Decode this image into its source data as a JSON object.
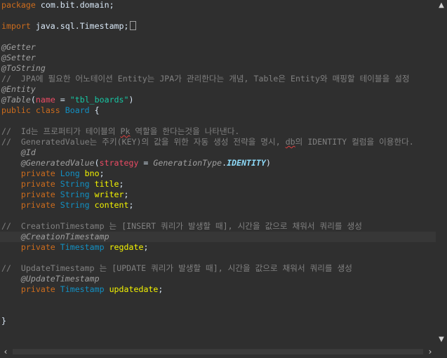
{
  "editor": {
    "lines": [
      {
        "tokens": [
          {
            "c": "kw",
            "t": "package"
          },
          {
            "c": "pl",
            "t": " com.bit.domain;"
          }
        ]
      },
      {
        "tokens": []
      },
      {
        "tokens": [
          {
            "c": "kw",
            "t": "import"
          },
          {
            "c": "pl",
            "t": " java.sql.Timestamp;"
          },
          {
            "c": "box",
            "t": ""
          }
        ]
      },
      {
        "tokens": []
      },
      {
        "tokens": [
          {
            "c": "an",
            "t": "@Getter"
          }
        ]
      },
      {
        "tokens": [
          {
            "c": "an",
            "t": "@Setter"
          }
        ]
      },
      {
        "tokens": [
          {
            "c": "an",
            "t": "@ToString"
          }
        ]
      },
      {
        "tokens": [
          {
            "c": "cm",
            "t": "//  JPA에 필요한 어노테이션 Entity는 JPA가 관리한다는 개념, Table은 Entity와 매핑할 테이블을 설정"
          }
        ]
      },
      {
        "tokens": [
          {
            "c": "an",
            "t": "@Entity"
          }
        ]
      },
      {
        "tokens": [
          {
            "c": "an",
            "t": "@Table"
          },
          {
            "c": "pl",
            "t": "("
          },
          {
            "c": "attr",
            "t": "name"
          },
          {
            "c": "pl",
            "t": " = "
          },
          {
            "c": "str",
            "t": "\"tbl_boards\""
          },
          {
            "c": "pl",
            "t": ")"
          }
        ]
      },
      {
        "tokens": [
          {
            "c": "kw",
            "t": "public class "
          },
          {
            "c": "cls",
            "t": "Board"
          },
          {
            "c": "pl",
            "t": " {"
          }
        ]
      },
      {
        "tokens": []
      },
      {
        "tokens": [
          {
            "c": "cm",
            "t": "//  Id는 프로퍼티가 테이블의 "
          },
          {
            "c": "cmsq",
            "t": "Pk"
          },
          {
            "c": "cm",
            "t": " 역할을 한다는것을 나타낸다."
          }
        ]
      },
      {
        "tokens": [
          {
            "c": "cm",
            "t": "//  GeneratedValue는 주키(KEY)의 값을 위한 자동 생성 전략을 명시, "
          },
          {
            "c": "cmsq",
            "t": "db"
          },
          {
            "c": "cm",
            "t": "의 IDENTITY 컬럼을 이용한다."
          }
        ]
      },
      {
        "tokens": [
          {
            "c": "pl",
            "t": "    "
          },
          {
            "c": "an",
            "t": "@Id"
          }
        ]
      },
      {
        "tokens": [
          {
            "c": "pl",
            "t": "    "
          },
          {
            "c": "an",
            "t": "@GeneratedValue"
          },
          {
            "c": "pl",
            "t": "("
          },
          {
            "c": "attr",
            "t": "strategy"
          },
          {
            "c": "pl",
            "t": " = "
          },
          {
            "c": "en",
            "t": "GenerationType"
          },
          {
            "c": "pl",
            "t": "."
          },
          {
            "c": "enc",
            "t": "IDENTITY"
          },
          {
            "c": "pl",
            "t": ")"
          }
        ]
      },
      {
        "tokens": [
          {
            "c": "pl",
            "t": "    "
          },
          {
            "c": "kw",
            "t": "private "
          },
          {
            "c": "ty",
            "t": "Long"
          },
          {
            "c": "pl",
            "t": " "
          },
          {
            "c": "var",
            "t": "bno"
          },
          {
            "c": "pl",
            "t": ";"
          }
        ]
      },
      {
        "tokens": [
          {
            "c": "pl",
            "t": "    "
          },
          {
            "c": "kw",
            "t": "private "
          },
          {
            "c": "ty",
            "t": "String"
          },
          {
            "c": "pl",
            "t": " "
          },
          {
            "c": "var",
            "t": "title"
          },
          {
            "c": "pl",
            "t": ";"
          }
        ]
      },
      {
        "tokens": [
          {
            "c": "pl",
            "t": "    "
          },
          {
            "c": "kw",
            "t": "private "
          },
          {
            "c": "ty",
            "t": "String"
          },
          {
            "c": "pl",
            "t": " "
          },
          {
            "c": "var",
            "t": "writer"
          },
          {
            "c": "pl",
            "t": ";"
          }
        ]
      },
      {
        "tokens": [
          {
            "c": "pl",
            "t": "    "
          },
          {
            "c": "kw",
            "t": "private "
          },
          {
            "c": "ty",
            "t": "String"
          },
          {
            "c": "pl",
            "t": " "
          },
          {
            "c": "var",
            "t": "content"
          },
          {
            "c": "pl",
            "t": ";"
          }
        ]
      },
      {
        "tokens": []
      },
      {
        "tokens": [
          {
            "c": "cm",
            "t": "//  CreationTimestamp 는 [INSERT 쿼리가 발생할 때], 시간을 값으로 채워서 쿼리를 생성"
          }
        ]
      },
      {
        "tokens": [
          {
            "c": "pl",
            "t": "    "
          },
          {
            "c": "an",
            "t": "@CreationTimestamp"
          }
        ],
        "current": true
      },
      {
        "tokens": [
          {
            "c": "pl",
            "t": "    "
          },
          {
            "c": "kw",
            "t": "private "
          },
          {
            "c": "ty",
            "t": "Timestamp"
          },
          {
            "c": "pl",
            "t": " "
          },
          {
            "c": "var",
            "t": "regdate"
          },
          {
            "c": "pl",
            "t": ";"
          }
        ]
      },
      {
        "tokens": []
      },
      {
        "tokens": [
          {
            "c": "cm",
            "t": "//  UpdateTimestamp 는 [UPDATE 쿼리가 발생할 때], 시간을 값으로 채워서 쿼리를 생성"
          }
        ]
      },
      {
        "tokens": [
          {
            "c": "pl",
            "t": "    "
          },
          {
            "c": "an",
            "t": "@UpdateTimestamp"
          }
        ]
      },
      {
        "tokens": [
          {
            "c": "pl",
            "t": "    "
          },
          {
            "c": "kw",
            "t": "private "
          },
          {
            "c": "ty",
            "t": "Timestamp"
          },
          {
            "c": "pl",
            "t": " "
          },
          {
            "c": "var",
            "t": "updatedate"
          },
          {
            "c": "pl",
            "t": ";"
          }
        ]
      },
      {
        "tokens": []
      },
      {
        "tokens": []
      },
      {
        "tokens": [
          {
            "c": "pl",
            "t": "}"
          }
        ]
      }
    ]
  },
  "scrollbars": {
    "vertical_up_icon": "chevron-up-icon",
    "vertical_down_icon": "chevron-down-icon",
    "horizontal_left_icon": "chevron-left-icon",
    "horizontal_right_icon": "chevron-right-icon",
    "up_glyph": "▲",
    "down_glyph": "▼",
    "left_glyph": "‹",
    "right_glyph": "›"
  },
  "colors": {
    "background": "#2f2f2f",
    "keyword": "#cc6c1d",
    "comment": "#808080",
    "annotation": "#a0a0a0",
    "type": "#1290c3",
    "string": "#17c6a3",
    "field": "#f2f200",
    "attribute": "#eb4b64",
    "plain": "#d9e8f7",
    "current_line": "#373737"
  }
}
